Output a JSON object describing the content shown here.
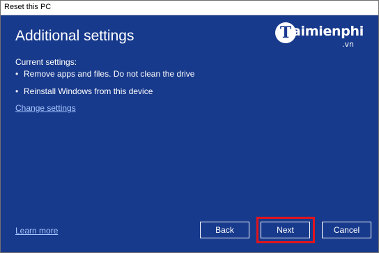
{
  "window": {
    "title": "Reset this PC"
  },
  "heading": "Additional settings",
  "watermark": {
    "mark": "T",
    "name": "aimienphi",
    "suffix": ".vn"
  },
  "current_settings": {
    "label": "Current settings:",
    "items": [
      {
        "bullet": "•",
        "text": "Remove apps and files. Do not clean the drive"
      },
      {
        "bullet": "•",
        "text": "Reinstall Windows from this device"
      }
    ]
  },
  "links": {
    "change_settings": "Change settings",
    "learn_more": "Learn more"
  },
  "buttons": {
    "back": "Back",
    "next": "Next",
    "cancel": "Cancel"
  },
  "colors": {
    "background": "#183a8c",
    "text": "#ffffff",
    "link": "#a7c5ff",
    "highlight": "#e0141e"
  }
}
